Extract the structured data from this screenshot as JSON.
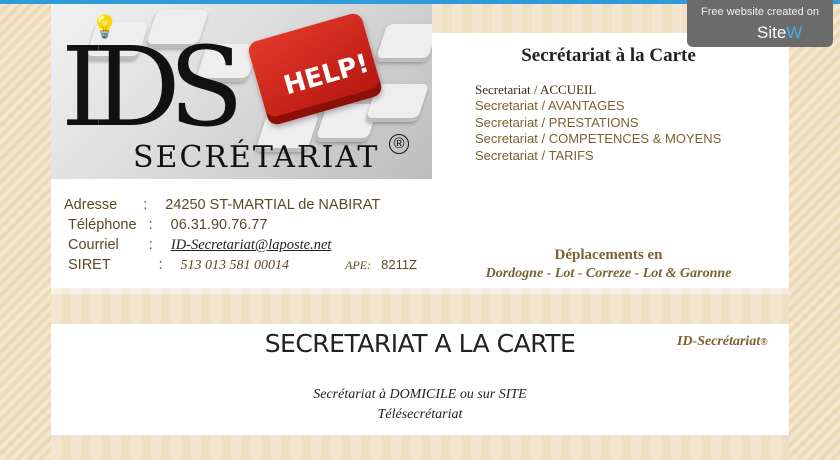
{
  "logo": {
    "word": "SECRÉTARIAT",
    "help": "HELP!",
    "reg": "®"
  },
  "site_title": "Secrétariat à la Carte",
  "nav": [
    {
      "label": "Secretariat / ACCUEIL",
      "active": true
    },
    {
      "label": "Secretariat / AVANTAGES",
      "active": false
    },
    {
      "label": "Secretariat / PRESTATIONS",
      "active": false
    },
    {
      "label": "Secretariat / COMPETENCES & MOYENS",
      "active": false
    },
    {
      "label": "Secretariat / TARIFS",
      "active": false
    }
  ],
  "contact": {
    "adresse_label": "Adresse",
    "adresse_value": "24250  ST-MARTIAL de NABIRAT",
    "telephone_label": "Téléphone",
    "telephone_value": "06.31.90.76.77",
    "courriel_label": "Courriel",
    "courriel_value": "ID-Secretariat@laposte.net",
    "siret_label": "SIRET",
    "siret_value": "513 013 581 00014",
    "ape_label": "APE:",
    "ape_value": "8211Z",
    "colon": ":"
  },
  "deplacements": {
    "line1": "Déplacements en",
    "line2": "Dordogne - Lot - Correze - Lot & Garonne"
  },
  "main": {
    "title": "SECRETARIAT A LA CARTE",
    "brand": "ID-Secrétariat",
    "brand_reg": "®",
    "subtitle_line1": "Secrétariat à DOMICILE ou sur SITE",
    "subtitle_line2": "Télésecrétariat"
  },
  "sitew_badge": {
    "line1": "Free website created on",
    "brand_main": "Site",
    "brand_accent": "W"
  },
  "colors": {
    "accent_blue": "#2f9bd8",
    "nav_brown": "#7a6232",
    "background_beige": "#f4e7cf",
    "help_red": "#d42a1f"
  }
}
